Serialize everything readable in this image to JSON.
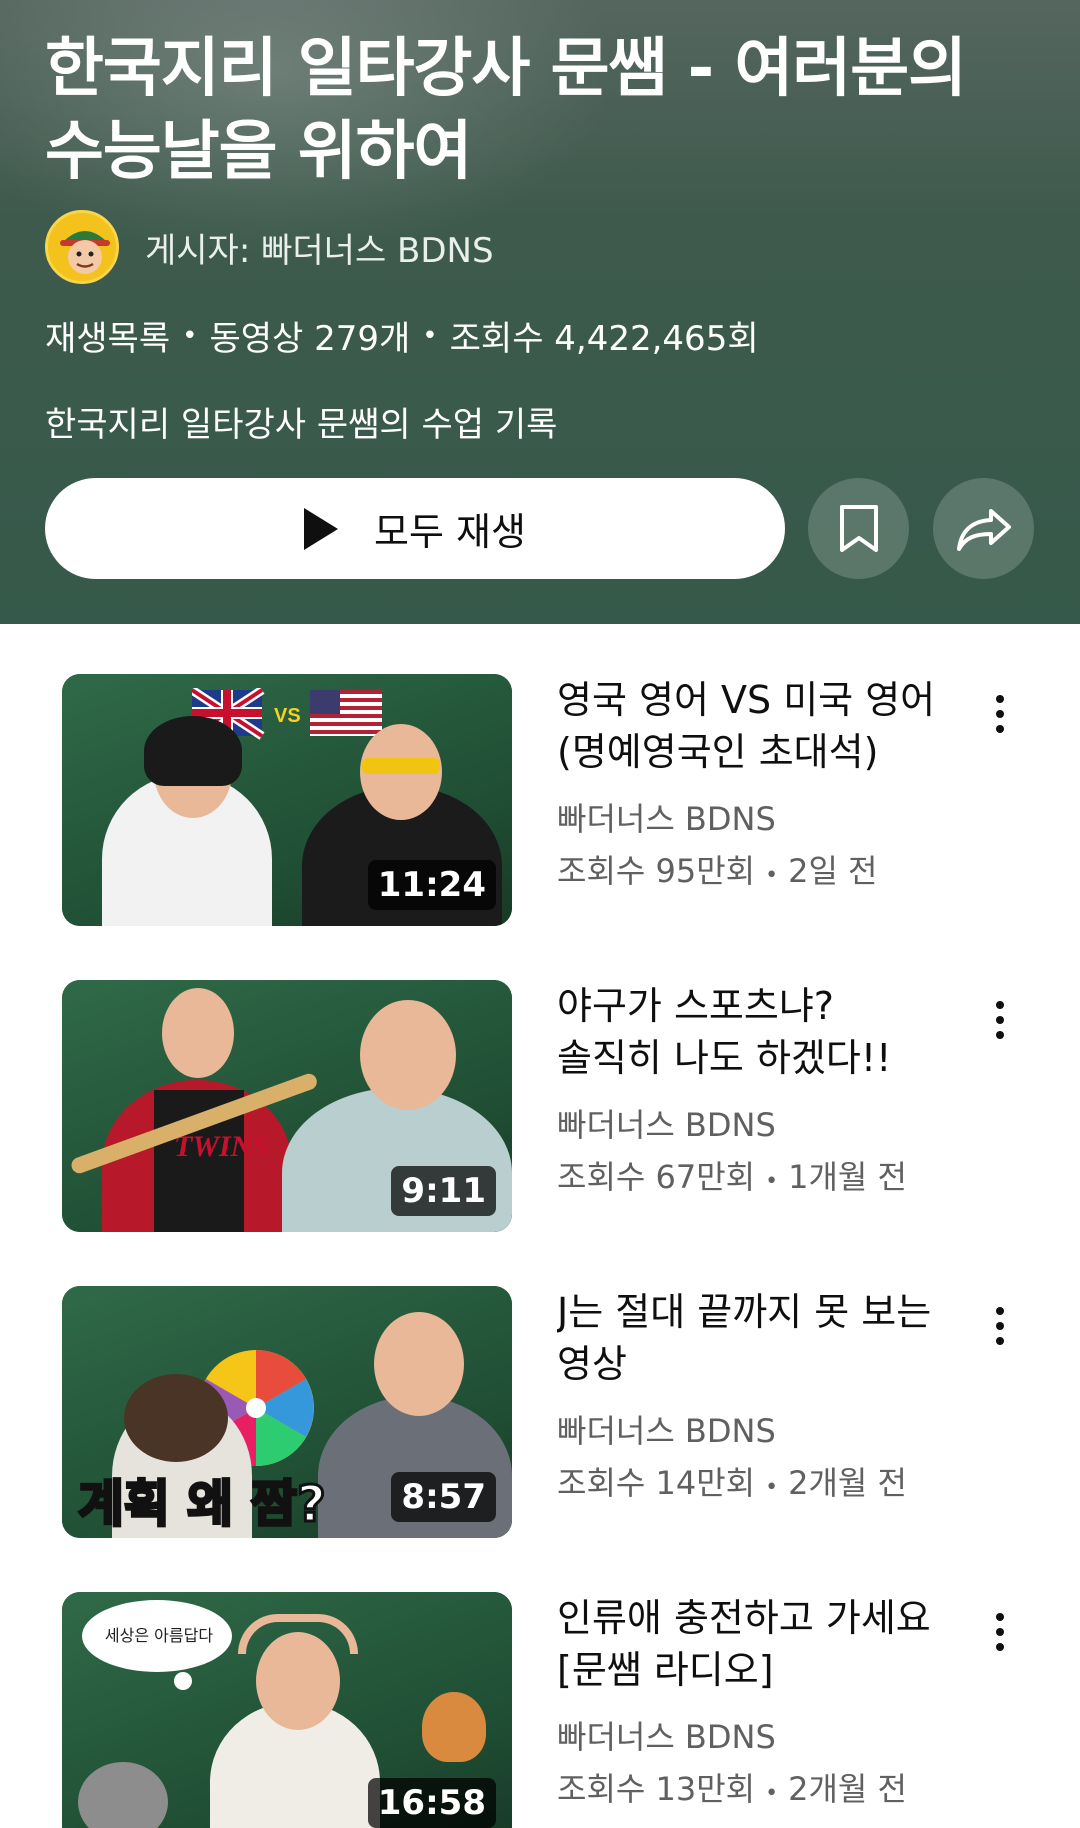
{
  "playlist": {
    "title": "한국지리 일타강사 문쌤 - 여러분의 수능날을 위하여",
    "owner_label": "게시자: 빠더너스 BDNS",
    "type_label": "재생목록",
    "video_count": "동영상 279개",
    "view_count": "조회수 4,422,465회",
    "description": "한국지리 일타강사 문쌤의 수업 기록",
    "play_all_label": "모두 재생",
    "header_color": "#3e5a4d"
  },
  "icons": {
    "avatar": "channel-avatar",
    "play": "play-icon",
    "save": "bookmark-icon",
    "share": "share-icon",
    "more": "more-vertical-icon"
  },
  "videos": [
    {
      "title": "영국 영어 VS 미국 영어 (명예영국인 초대석)",
      "channel": "빠더너스 BDNS",
      "views": "조회수 95만회",
      "age": "2일 전",
      "duration": "11:24",
      "thumb_text": "VS"
    },
    {
      "title": "야구가 스포츠냐? 솔직히 나도 하겠다!!",
      "channel": "빠더너스 BDNS",
      "views": "조회수 67만회",
      "age": "1개월 전",
      "duration": "9:11",
      "thumb_text": "TWINS"
    },
    {
      "title": "J는 절대 끝까지 못 보는 영상",
      "channel": "빠더너스 BDNS",
      "views": "조회수 14만회",
      "age": "2개월 전",
      "duration": "8:57",
      "thumb_text": "계획 왜 짬?"
    },
    {
      "title": "인류애 충전하고 가세요 [문쌤 라디오]",
      "channel": "빠더너스 BDNS",
      "views": "조회수 13만회",
      "age": "2개월 전",
      "duration": "16:58",
      "thumb_text": "세상은 아름답다"
    }
  ]
}
